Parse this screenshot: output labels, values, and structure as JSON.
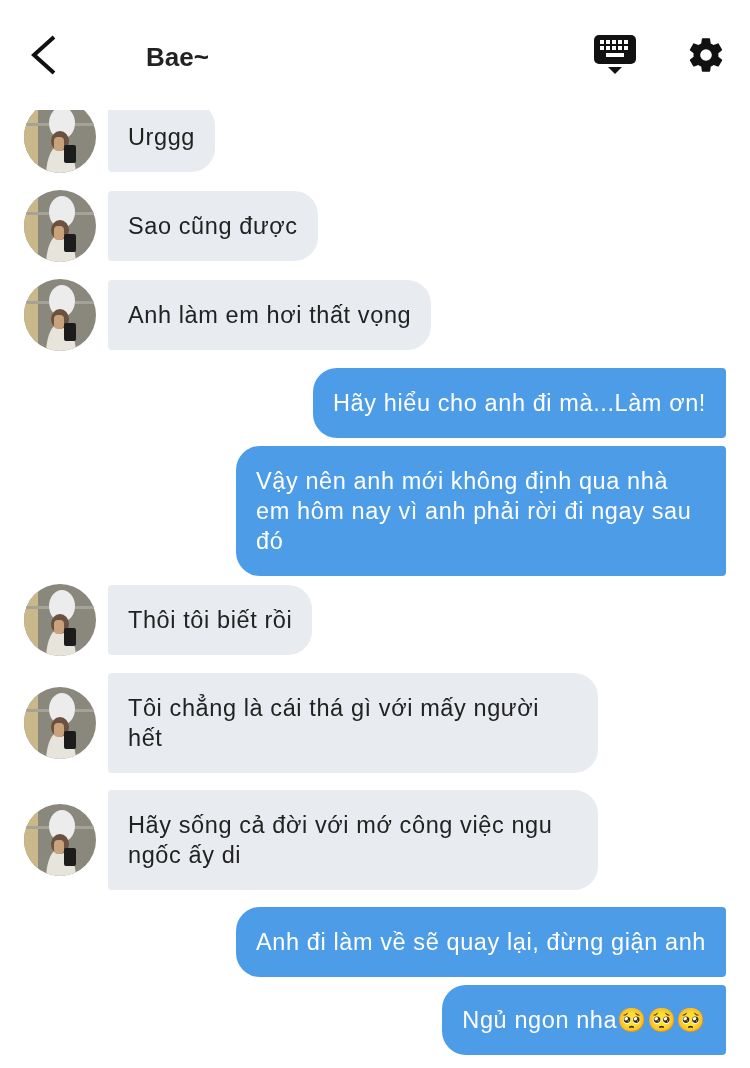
{
  "header": {
    "title": "Bae~"
  },
  "messages": [
    {
      "kind": "incoming",
      "text": "Urggg"
    },
    {
      "kind": "incoming",
      "text": "Sao cũng được"
    },
    {
      "kind": "incoming",
      "text": "Anh làm em hơi thất vọng"
    },
    {
      "kind": "outgoing",
      "text": "Hãy hiểu cho anh đi mà...Làm ơn!"
    },
    {
      "kind": "outgoing",
      "text": "Vậy nên anh mới không định qua nhà em hôm nay vì anh phải rời đi ngay sau đó"
    },
    {
      "kind": "incoming",
      "text": "Thôi tôi biết rồi"
    },
    {
      "kind": "incoming",
      "text": "Tôi chẳng là cái thá gì với mấy người hết"
    },
    {
      "kind": "incoming",
      "text": "Hãy sống cả đời với mớ công việc ngu ngốc ấy di"
    },
    {
      "kind": "outgoing",
      "text": "Anh đi làm về sẽ quay lại, đừng giận anh"
    },
    {
      "kind": "outgoing",
      "text": "Ngủ ngon nha🥺🥺🥺"
    }
  ]
}
